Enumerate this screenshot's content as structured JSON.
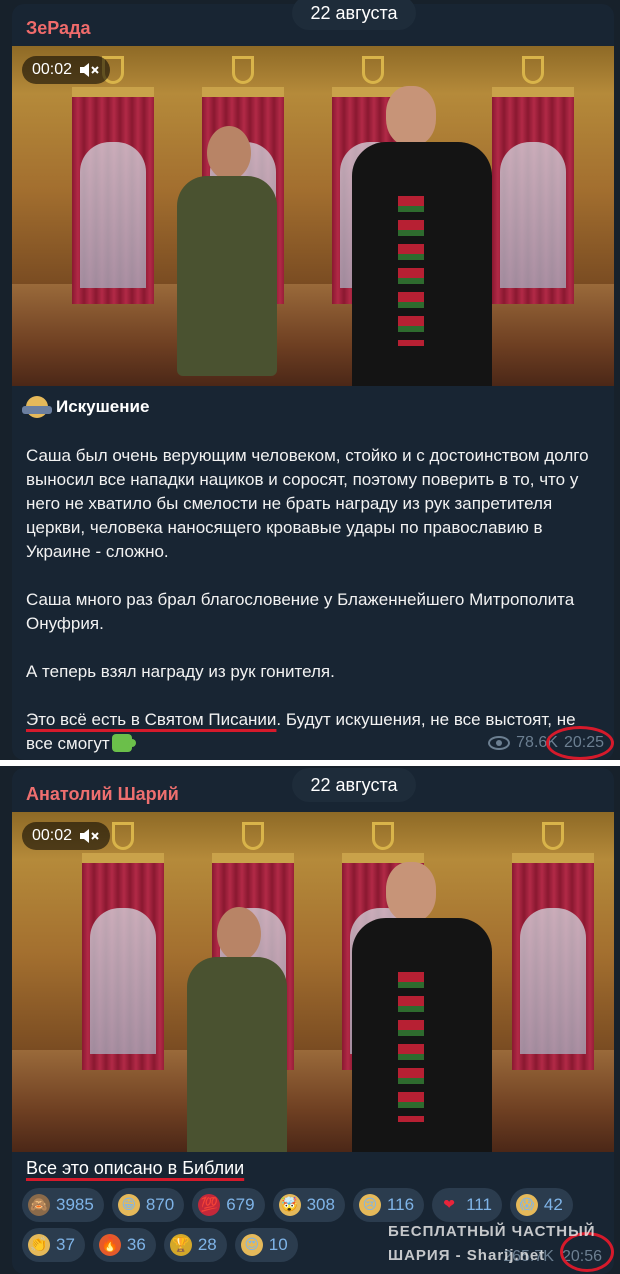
{
  "post1": {
    "date": "22 августа",
    "channel": "ЗеРада",
    "video_time": "00:02",
    "title": "Искушение",
    "paragraph1": "Саша был очень верующим человеком, стойко и с достоинством долго выносил все нападки нациков и соросят, поэтому поверить в то, что у него не хватило бы смелости не брать награду из рук запретителя церкви, человека наносящего кровавые удары по православию в Украине - сложно.",
    "paragraph2": "Саша много раз брал благословение у Блаженнейшего Митрополита Онуфрия.",
    "paragraph3": "А теперь взял награду из рук гонителя.",
    "paragraph4_underlined": "Это всё есть в Святом Писании",
    "paragraph4_rest": ". Будут искушения, не все выстоят, не все смогут",
    "views": "78.6K",
    "time": "20:25"
  },
  "post2": {
    "date": "22 августа",
    "channel": "Анатолий Шарий",
    "video_time": "00:02",
    "caption": "Все это описано в Библии",
    "reactions": [
      {
        "icon": "see-no-evil-monkey-icon",
        "glyph": "🙈",
        "count": "3985",
        "bg": "#8a6a4a"
      },
      {
        "icon": "grinning-face-icon",
        "glyph": "😁",
        "count": "870",
        "bg": "#e5b95a"
      },
      {
        "icon": "hundred-points-icon",
        "glyph": "💯",
        "count": "679",
        "bg": "#c4283a"
      },
      {
        "icon": "exploding-head-icon",
        "glyph": "🤯",
        "count": "308",
        "bg": "#e5b95a"
      },
      {
        "icon": "crying-face-icon",
        "glyph": "😢",
        "count": "116",
        "bg": "#e5b95a"
      },
      {
        "icon": "red-heart-icon",
        "glyph": "❤",
        "count": "111",
        "bg": "transparent"
      },
      {
        "icon": "screaming-face-icon",
        "glyph": "😱",
        "count": "42",
        "bg": "#e5b95a"
      },
      {
        "icon": "clapping-hands-icon",
        "glyph": "👏",
        "count": "37",
        "bg": "#e5b95a"
      },
      {
        "icon": "fire-icon",
        "glyph": "🔥",
        "count": "36",
        "bg": "#e55a2a"
      },
      {
        "icon": "trophy-icon",
        "glyph": "🏆",
        "count": "28",
        "bg": "#d4a82a"
      },
      {
        "icon": "heart-eyes-icon",
        "glyph": "😍",
        "count": "10",
        "bg": "#e5b95a"
      }
    ],
    "views": "265.7K",
    "time": "20:56",
    "watermark_line1": "БЕСПЛАТНЫЙ ЧАСТНЫЙ",
    "watermark_line2": "ШАРИЯ - Sharij.net"
  },
  "colors": {
    "background": "#0e1621",
    "bubble": "#182533",
    "channel_name": "#f06b6b",
    "meta": "#6c7f91",
    "reaction_bg": "#2b3c4e",
    "reaction_text": "#7fb4e8",
    "annotation_red": "#d61a2b"
  }
}
